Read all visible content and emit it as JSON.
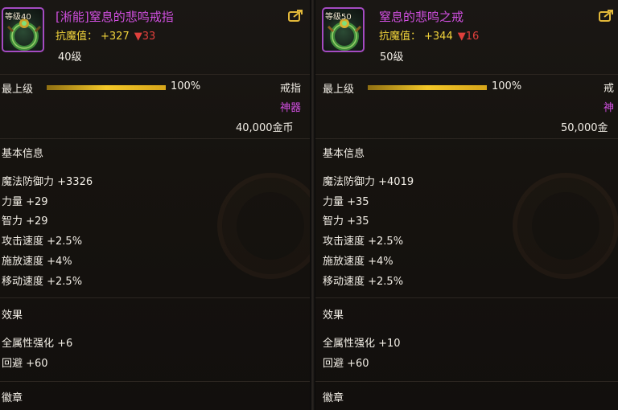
{
  "panels": [
    {
      "level_badge": "等级40",
      "name": "[淅能]窒息的悲鸣戒指",
      "resist_label": "抗魔值：",
      "resist_value": "+327",
      "resist_down": "▼33",
      "level_text": "40级",
      "max_level_label": "最上级",
      "progress_percent": 100,
      "progress_text": "100%",
      "type": "戒指",
      "rarity": "神器",
      "price": "40,000金币",
      "basic_title": "基本信息",
      "stats": [
        "魔法防御力 +3326",
        "力量 +29",
        "智力 +29",
        "攻击速度 +2.5%",
        "施放速度 +4%",
        "移动速度 +2.5%"
      ],
      "effect_title": "效果",
      "effects": [
        "全属性强化 +6",
        "回避 +60"
      ],
      "emblem_title": "徽章"
    },
    {
      "level_badge": "等级50",
      "name": "窒息的悲鸣之戒",
      "resist_label": "抗魔值：",
      "resist_value": "+344",
      "resist_down": "▼16",
      "level_text": "50级",
      "max_level_label": "最上级",
      "progress_percent": 100,
      "progress_text": "100%",
      "type": "戒",
      "rarity": "神",
      "price": "50,000金",
      "basic_title": "基本信息",
      "stats": [
        "魔法防御力 +4019",
        "力量 +35",
        "智力 +35",
        "攻击速度 +2.5%",
        "施放速度 +4%",
        "移动速度 +2.5%"
      ],
      "effect_title": "效果",
      "effects": [
        "全属性强化 +10",
        "回避 +60"
      ],
      "emblem_title": "徽章"
    }
  ],
  "icons": {
    "item": "ring-icon",
    "share": "share-icon"
  },
  "colors": {
    "artifact_purple": "#d14fe0",
    "resist_gold": "#f0d23b",
    "down_red": "#e0403c",
    "bar_gold": "#f3c728"
  }
}
